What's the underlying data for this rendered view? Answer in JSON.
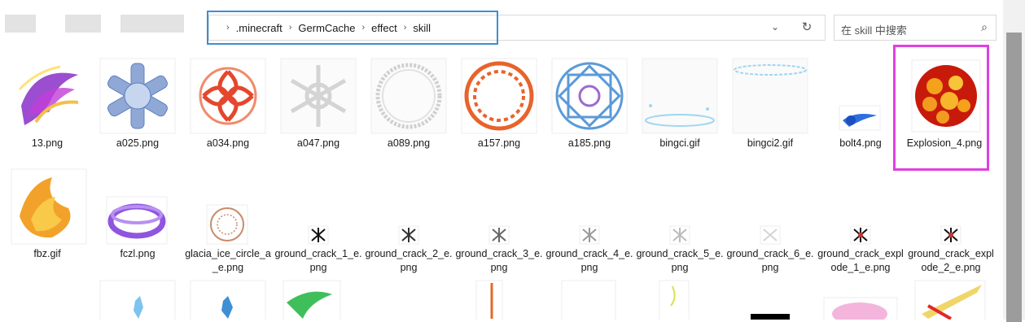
{
  "addressbar": {
    "path": [
      ".minecraft",
      "GermCache",
      "effect",
      "skill"
    ],
    "search_placeholder": "在 skill 中搜索"
  },
  "colors": {
    "highlight_blue": "#3d8fd1",
    "highlight_pink": "#e040e0"
  },
  "files": [
    {
      "name": "13.png",
      "icon": "swirl-purple-thumb"
    },
    {
      "name": "a025.png",
      "icon": "snowflake-blue-thumb"
    },
    {
      "name": "a034.png",
      "icon": "flower-red-thumb"
    },
    {
      "name": "a047.png",
      "icon": "snowflake-white-thumb"
    },
    {
      "name": "a089.png",
      "icon": "ring-white-thumb"
    },
    {
      "name": "a157.png",
      "icon": "rune-ring-orange-thumb"
    },
    {
      "name": "a185.png",
      "icon": "magic-circle-blue-thumb"
    },
    {
      "name": "bingci.gif",
      "icon": "ice-platform-thumb"
    },
    {
      "name": "bingci2.gif",
      "icon": "ice-platform-thumb"
    },
    {
      "name": "bolt4.png",
      "icon": "blue-bolt-thumb"
    },
    {
      "name": "Explosion_4.png",
      "icon": "explosion-thumb"
    },
    {
      "name": "fbz.gif",
      "icon": "fire-burst-thumb"
    },
    {
      "name": "fczl.png",
      "icon": "purple-chain-thumb"
    },
    {
      "name": "glacia_ice_circle_a_e.png",
      "icon": "rune-circle-thumb"
    },
    {
      "name": "ground_crack_1_e.png",
      "icon": "ground-crack-thumb"
    },
    {
      "name": "ground_crack_2_e.png",
      "icon": "ground-crack-thumb"
    },
    {
      "name": "ground_crack_3_e.png",
      "icon": "ground-crack-thumb"
    },
    {
      "name": "ground_crack_4_e.png",
      "icon": "ground-crack-thumb"
    },
    {
      "name": "ground_crack_5_e.png",
      "icon": "ground-crack-thumb"
    },
    {
      "name": "ground_crack_6_e.png",
      "icon": "ground-crack-thumb"
    },
    {
      "name": "ground_crack_explode_1_e.png",
      "icon": "ground-crack-thumb"
    },
    {
      "name": "ground_crack_explode_2_e.png",
      "icon": "ground-crack-thumb"
    }
  ]
}
